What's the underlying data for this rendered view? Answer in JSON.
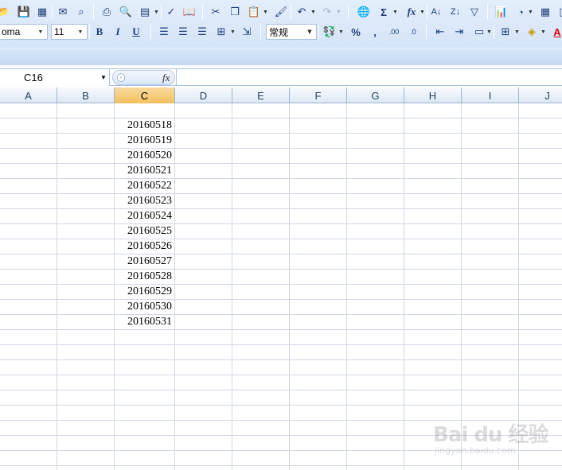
{
  "toolbar": {
    "font_name": "oma",
    "font_size": "11",
    "number_format": "常规",
    "percent_label": "%",
    "comma_label": ",",
    "sum_label": "Σ",
    "fx_label": "fx",
    "bold_label": "B",
    "italic_label": "I",
    "underline_label": "U"
  },
  "formula_bar": {
    "name_box": "C16",
    "fx_label": "fx",
    "content": ""
  },
  "columns": [
    "A",
    "B",
    "C",
    "D",
    "E",
    "F",
    "G",
    "H",
    "I",
    "J"
  ],
  "active_column": "C",
  "cells": {
    "column": "C",
    "values": [
      "20160518",
      "20160519",
      "20160520",
      "20160521",
      "20160522",
      "20160523",
      "20160524",
      "20160525",
      "20160526",
      "20160527",
      "20160528",
      "20160529",
      "20160530",
      "20160531"
    ]
  },
  "watermark": {
    "main": "Bai du 经验",
    "sub": "jingyan.baidu.com"
  }
}
